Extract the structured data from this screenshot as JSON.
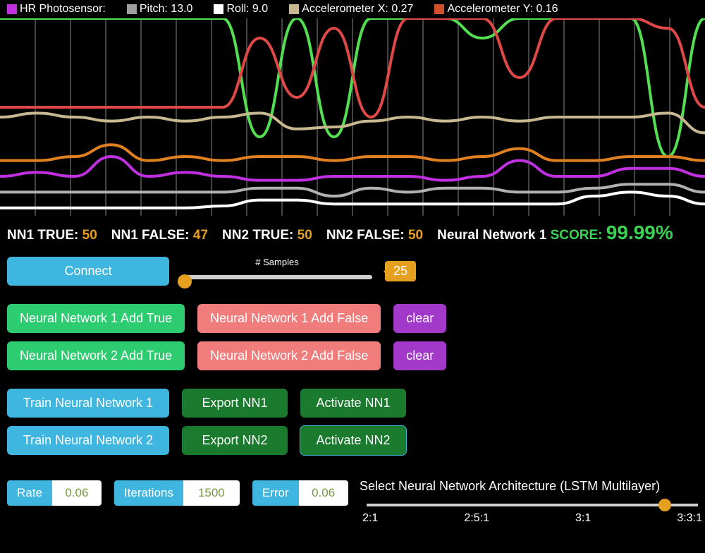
{
  "legend": [
    {
      "color": "#c030e0",
      "label": "HR Photosensor:"
    },
    {
      "color": "#a0a0a0",
      "label": "Pitch: 13.0"
    },
    {
      "color": "#ffffff",
      "label": "Roll: 9.0"
    },
    {
      "color": "#c8b890",
      "label": "Accelerometer X: 0.27"
    },
    {
      "color": "#d0502a",
      "label": "Accelerometer Y: 0.16"
    }
  ],
  "stats": {
    "nn1_true_label": "NN1 TRUE:",
    "nn1_true": "50",
    "nn1_false_label": "NN1 FALSE:",
    "nn1_false": "47",
    "nn2_true_label": "NN2 TRUE:",
    "nn2_true": "50",
    "nn2_false_label": "NN2 FALSE:",
    "nn2_false": "50",
    "score_title": "Neural Network 1",
    "score_word": "SCORE:",
    "score_val": "99.99%"
  },
  "connect": "Connect",
  "samples_label": "# Samples",
  "samples_value": "25",
  "buttons": {
    "nn1_add_true": "Neural Network 1 Add True",
    "nn1_add_false": "Neural Network 1 Add False",
    "nn2_add_true": "Neural Network 2 Add True",
    "nn2_add_false": "Neural Network 2 Add False",
    "clear": "clear",
    "train1": "Train Neural Network 1",
    "train2": "Train Neural Network 2",
    "export1": "Export NN1",
    "export2": "Export NN2",
    "activate1": "Activate NN1",
    "activate2": "Activate NN2"
  },
  "params": {
    "rate_label": "Rate",
    "rate_value": "0.06",
    "iter_label": "Iterations",
    "iter_value": "1500",
    "error_label": "Error",
    "error_value": "0.06"
  },
  "arch": {
    "title": "Select Neural Network Architecture (LSTM Multilayer)",
    "ticks": [
      "2:1",
      "2:5:1",
      "3:1",
      "3:3:1"
    ]
  },
  "chart_data": {
    "type": "line",
    "x_range": [
      0,
      100
    ],
    "y_range": [
      0,
      1
    ],
    "grid_vertical_lines": 19,
    "note": "values approximated from pixels; arbitrary y units 0-1",
    "series": [
      {
        "name": "green",
        "color": "#52e052",
        "values": [
          1,
          1,
          1,
          1,
          1,
          1,
          1,
          0.4,
          1,
          0.4,
          1,
          1,
          1,
          0.9,
          1,
          1,
          1,
          1,
          0.3,
          1
        ]
      },
      {
        "name": "red",
        "color": "#e04848",
        "values": [
          0.55,
          0.55,
          0.55,
          0.55,
          0.55,
          0.55,
          0.55,
          0.9,
          0.6,
          0.95,
          0.5,
          1,
          1,
          1,
          0.7,
          1,
          1,
          1,
          0.95,
          0.55
        ]
      },
      {
        "name": "tan",
        "color": "#c8b890",
        "values": [
          0.5,
          0.52,
          0.5,
          0.48,
          0.5,
          0.48,
          0.5,
          0.52,
          0.44,
          0.45,
          0.48,
          0.5,
          0.48,
          0.5,
          0.48,
          0.5,
          0.5,
          0.5,
          0.52,
          0.42
        ]
      },
      {
        "name": "orange",
        "color": "#e08020",
        "values": [
          0.28,
          0.28,
          0.3,
          0.36,
          0.28,
          0.3,
          0.28,
          0.3,
          0.3,
          0.28,
          0.3,
          0.3,
          0.28,
          0.3,
          0.34,
          0.28,
          0.28,
          0.3,
          0.3,
          0.28
        ]
      },
      {
        "name": "magenta",
        "color": "#c030e0",
        "values": [
          0.2,
          0.22,
          0.2,
          0.3,
          0.2,
          0.22,
          0.2,
          0.18,
          0.18,
          0.2,
          0.2,
          0.2,
          0.18,
          0.2,
          0.28,
          0.2,
          0.2,
          0.24,
          0.24,
          0.2
        ]
      },
      {
        "name": "gray",
        "color": "#b0b0b0",
        "values": [
          0.12,
          0.12,
          0.12,
          0.12,
          0.12,
          0.12,
          0.12,
          0.14,
          0.14,
          0.1,
          0.14,
          0.12,
          0.14,
          0.14,
          0.12,
          0.12,
          0.14,
          0.16,
          0.16,
          0.12
        ]
      },
      {
        "name": "white",
        "color": "#ffffff",
        "values": [
          0.04,
          0.04,
          0.04,
          0.04,
          0.04,
          0.04,
          0.05,
          0.08,
          0.08,
          0.06,
          0.06,
          0.06,
          0.06,
          0.06,
          0.06,
          0.06,
          0.1,
          0.12,
          0.1,
          0.06
        ]
      }
    ]
  }
}
